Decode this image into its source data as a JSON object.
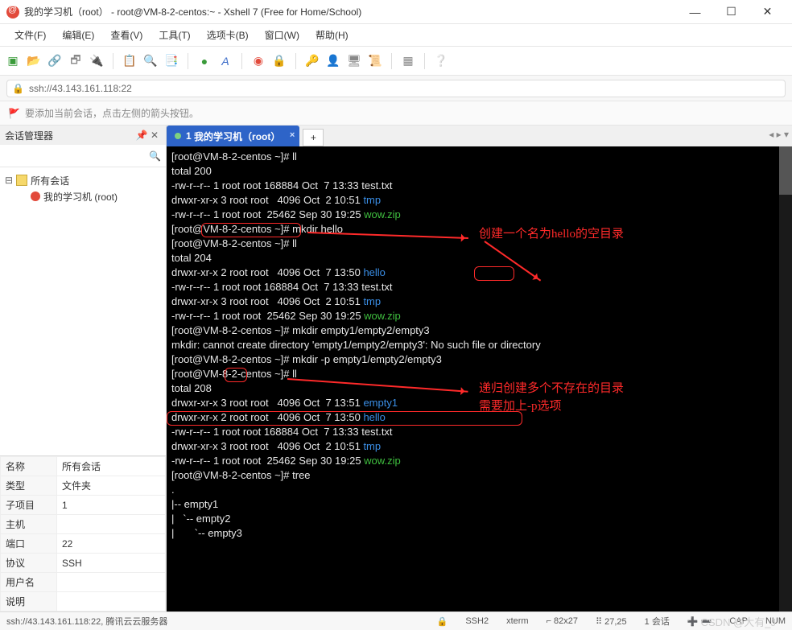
{
  "title": "我的学习机（root）  - root@VM-8-2-centos:~ - Xshell 7 (Free for Home/School)",
  "menu": [
    "文件(F)",
    "编辑(E)",
    "查看(V)",
    "工具(T)",
    "选项卡(B)",
    "窗口(W)",
    "帮助(H)"
  ],
  "address": "ssh://43.143.161.118:22",
  "notice": "要添加当前会话，点击左侧的箭头按钮。",
  "side_hdr": "会话管理器",
  "tree": {
    "root": "所有会话",
    "item1": "我的学习机 (root)"
  },
  "props_labels": {
    "name": "名称",
    "type": "类型",
    "subitems": "子项目",
    "host": "主机",
    "port": "端口",
    "protocol": "协议",
    "user": "用户名",
    "note": "说明"
  },
  "props_values": {
    "name": "所有会话",
    "type": "文件夹",
    "subitems": "1",
    "host": "",
    "port": "22",
    "protocol": "SSH",
    "user": "",
    "note": ""
  },
  "tab": {
    "idx": "1",
    "label": "我的学习机（root）"
  },
  "term": {
    "p": "[root@VM-8-2-centos ~]#",
    "l1": "ll",
    "l2": "total 200",
    "l3": "-rw-r--r-- 1 root root 168884 Oct  7 13:33 test.txt",
    "l4a": "drwxr-xr-x 3 root root   4096 Oct  2 10:51 ",
    "l4b": "tmp",
    "l5a": "-rw-r--r-- 1 root root  25462 Sep 30 19:25 ",
    "l5b": "wow.zip",
    "l6": "mkdir hello",
    "l7": "ll",
    "l8": "total 204",
    "l9a": "drwxr-xr-x 2 root root   4096 Oct  7 13:50 ",
    "l9b": "hello",
    "l10": "-rw-r--r-- 1 root root 168884 Oct  7 13:33 test.txt",
    "l11a": "drwxr-xr-x 3 root root   4096 Oct  2 10:51 ",
    "l11b": "tmp",
    "l12a": "-rw-r--r-- 1 root root  25462 Sep 30 19:25 ",
    "l12b": "wow.zip",
    "l13": "mkdir empty1/empty2/empty3",
    "l14": "mkdir: cannot create directory 'empty1/empty2/empty3': No such file or directory",
    "l15": "mkdir -p empty1/empty2/empty3",
    "l16": "ll",
    "l17": "total 208",
    "l18a": "drwxr-xr-x 3 root root   4096 Oct  7 13:51 ",
    "l18b": "empty1",
    "l19a": "drwxr-xr-x 2 root root   4096 Oct  7 13:50 ",
    "l19b": "hello",
    "l20": "-rw-r--r-- 1 root root 168884 Oct  7 13:33 test.txt",
    "l21a": "drwxr-xr-x 3 root root   4096 Oct  2 10:51 ",
    "l21b": "tmp",
    "l22a": "-rw-r--r-- 1 root root  25462 Sep 30 19:25 ",
    "l22b": "wow.zip",
    "l23": "tree",
    "l24": ".",
    "l25": "|-- empty1",
    "l26": "|   `-- empty2",
    "l27": "|       `-- empty3"
  },
  "anno": {
    "a1": "创建一个名为hello的空目录",
    "a2": "递归创建多个不存在的目录",
    "a3": "需要加上-p选项"
  },
  "status": {
    "conn": "ssh://43.143.161.118:22, 腾讯云云服务器",
    "proto": "SSH2",
    "term": "xterm",
    "size": "⌐ 82x27",
    "pos": "⠿ 27,25",
    "sess": "1 会话",
    "cap": "CAP",
    "num": "NUM"
  },
  "watermark": "CSDN @大有_J"
}
